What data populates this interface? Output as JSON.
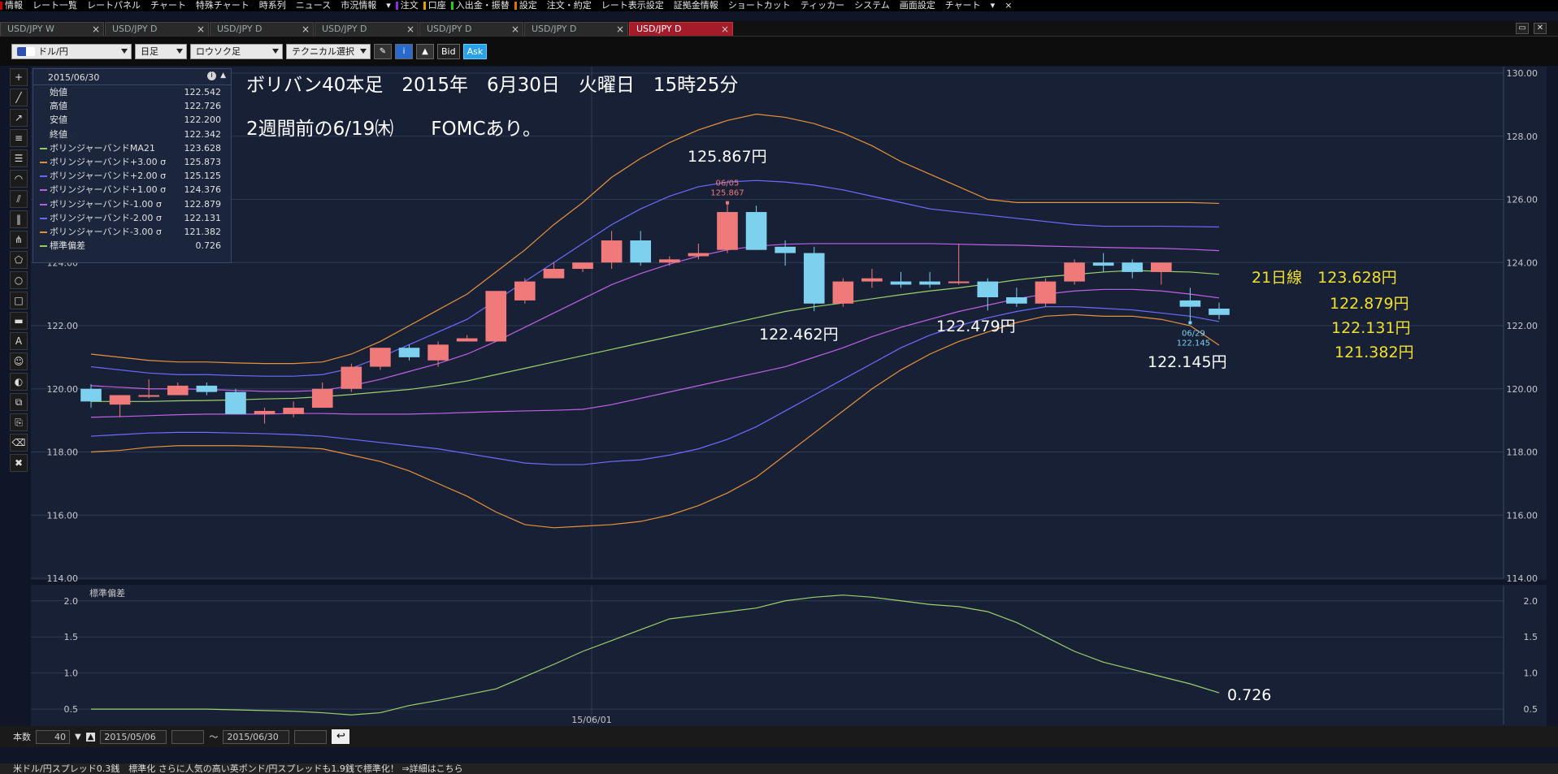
{
  "menu": [
    "情報",
    "レート一覧",
    "レートパネル",
    "チャート",
    "特殊チャート",
    "時系列",
    "ニュース",
    "市況情報",
    "▾",
    "注文",
    "口座",
    "入出金・振替",
    "設定",
    "注文・約定",
    "レート表示設定",
    "証拠金情報",
    "ショートカット",
    "ティッカー",
    "システム",
    "画面設定",
    "チャート",
    "▾",
    "×"
  ],
  "tabs": [
    {
      "label": "USD/JPY W",
      "active": false
    },
    {
      "label": "USD/JPY D",
      "active": false
    },
    {
      "label": "USD/JPY D",
      "active": false
    },
    {
      "label": "USD/JPY D",
      "active": false
    },
    {
      "label": "USD/JPY D",
      "active": false
    },
    {
      "label": "USD/JPY D",
      "active": false
    },
    {
      "label": "USD/JPY D",
      "active": true
    }
  ],
  "toolbar": {
    "pair": "ドル/円",
    "period": "日足",
    "chart_type": "ロウソク足",
    "technical": "テクニカル選択",
    "bid": "Bid",
    "ask": "Ask"
  },
  "info": {
    "date": "2015/06/30",
    "rows": [
      {
        "label": "始値",
        "value": "122.542",
        "color": ""
      },
      {
        "label": "高値",
        "value": "122.726",
        "color": ""
      },
      {
        "label": "安値",
        "value": "122.200",
        "color": ""
      },
      {
        "label": "終値",
        "value": "122.342",
        "color": ""
      },
      {
        "label": "ボリンジャーバンドMA21",
        "value": "123.628",
        "color": "#9ad26a"
      },
      {
        "label": "ボリンジャーバンド+3.00 σ",
        "value": "125.873",
        "color": "#e89238"
      },
      {
        "label": "ボリンジャーバンド+2.00 σ",
        "value": "125.125",
        "color": "#6c6cff"
      },
      {
        "label": "ボリンジャーバンド+1.00 σ",
        "value": "124.376",
        "color": "#c060e8"
      },
      {
        "label": "ボリンジャーバンド-1.00 σ",
        "value": "122.879",
        "color": "#c060e8"
      },
      {
        "label": "ボリンジャーバンド-2.00 σ",
        "value": "122.131",
        "color": "#6c6cff"
      },
      {
        "label": "ボリンジャーバンド-3.00 σ",
        "value": "121.382",
        "color": "#e89238"
      },
      {
        "label": "標準偏差",
        "value": "0.726",
        "color": "#9ad26a"
      }
    ]
  },
  "annotations": {
    "title": "ボリバン40本足　2015年　6月30日　火曜日　15時25分",
    "subtitle": "2週間前の6/19㈭　　FOMCあり。",
    "high_label": "125.867円",
    "low1": "122.462円",
    "low2": "122.479円",
    "low3": "122.145円",
    "ma21": "21日線　123.628円",
    "m1": "122.879円",
    "m2": "122.131円",
    "m3": "121.382円",
    "sd": "0.726",
    "hi_marker_date": "06/05",
    "hi_marker_val": "125.867",
    "lo_marker_date": "06/29",
    "lo_marker_val": "122.145",
    "sd_panel_label": "標準偏差",
    "x_tick": "15/06/01"
  },
  "chart_data": {
    "type": "candlestick",
    "ylim": [
      114,
      130
    ],
    "yticks": [
      "130.00",
      "128.00",
      "126.00",
      "124.00",
      "122.00",
      "120.00",
      "118.00",
      "116.00",
      "114.00"
    ],
    "sd_ylim": [
      0.4,
      2.2
    ],
    "sd_yticks": [
      "2.0",
      "1.5",
      "1.0",
      "0.5"
    ],
    "colors": {
      "up": "#f07a7a",
      "down": "#7dd0ee",
      "ma": "#9ad26a",
      "sigma1": "#c060e8",
      "sigma2": "#6c6cff",
      "sigma3": "#e89238",
      "sd": "#9ad26a"
    },
    "candles": [
      {
        "o": 120.0,
        "h": 120.15,
        "l": 119.4,
        "c": 119.6
      },
      {
        "o": 119.5,
        "h": 119.8,
        "l": 119.1,
        "c": 119.8
      },
      {
        "o": 119.8,
        "h": 120.3,
        "l": 119.7,
        "c": 119.8
      },
      {
        "o": 119.8,
        "h": 120.2,
        "l": 119.8,
        "c": 120.1
      },
      {
        "o": 120.1,
        "h": 120.2,
        "l": 119.8,
        "c": 119.9
      },
      {
        "o": 119.9,
        "h": 120.0,
        "l": 119.2,
        "c": 119.2
      },
      {
        "o": 119.2,
        "h": 119.4,
        "l": 118.9,
        "c": 119.3
      },
      {
        "o": 119.2,
        "h": 119.6,
        "l": 119.1,
        "c": 119.4
      },
      {
        "o": 119.4,
        "h": 120.2,
        "l": 119.4,
        "c": 120.0
      },
      {
        "o": 120.0,
        "h": 120.8,
        "l": 119.9,
        "c": 120.7
      },
      {
        "o": 120.7,
        "h": 121.3,
        "l": 120.6,
        "c": 121.3
      },
      {
        "o": 121.3,
        "h": 121.4,
        "l": 120.9,
        "c": 121.0
      },
      {
        "o": 120.9,
        "h": 121.5,
        "l": 120.7,
        "c": 121.4
      },
      {
        "o": 121.5,
        "h": 121.7,
        "l": 121.5,
        "c": 121.6
      },
      {
        "o": 121.5,
        "h": 123.1,
        "l": 121.5,
        "c": 123.1
      },
      {
        "o": 122.8,
        "h": 123.5,
        "l": 122.7,
        "c": 123.4
      },
      {
        "o": 123.5,
        "h": 124.0,
        "l": 123.5,
        "c": 123.8
      },
      {
        "o": 123.8,
        "h": 124.0,
        "l": 123.7,
        "c": 124.0
      },
      {
        "o": 124.0,
        "h": 125.0,
        "l": 123.8,
        "c": 124.7
      },
      {
        "o": 124.7,
        "h": 125.0,
        "l": 123.9,
        "c": 124.0
      },
      {
        "o": 124.0,
        "h": 124.2,
        "l": 123.9,
        "c": 124.1
      },
      {
        "o": 124.2,
        "h": 124.6,
        "l": 124.1,
        "c": 124.3
      },
      {
        "o": 124.4,
        "h": 125.87,
        "l": 124.3,
        "c": 125.6
      },
      {
        "o": 125.6,
        "h": 125.8,
        "l": 124.4,
        "c": 124.4
      },
      {
        "o": 124.5,
        "h": 124.7,
        "l": 123.9,
        "c": 124.3
      },
      {
        "o": 124.3,
        "h": 124.5,
        "l": 122.46,
        "c": 122.7
      },
      {
        "o": 122.7,
        "h": 123.5,
        "l": 122.6,
        "c": 123.4
      },
      {
        "o": 123.4,
        "h": 123.8,
        "l": 123.2,
        "c": 123.5
      },
      {
        "o": 123.4,
        "h": 123.7,
        "l": 123.2,
        "c": 123.3
      },
      {
        "o": 123.4,
        "h": 123.7,
        "l": 123.2,
        "c": 123.3
      },
      {
        "o": 123.4,
        "h": 124.6,
        "l": 123.3,
        "c": 123.4
      },
      {
        "o": 123.4,
        "h": 123.5,
        "l": 122.48,
        "c": 122.9
      },
      {
        "o": 122.9,
        "h": 123.2,
        "l": 122.6,
        "c": 122.7
      },
      {
        "o": 122.7,
        "h": 123.5,
        "l": 122.6,
        "c": 123.4
      },
      {
        "o": 123.4,
        "h": 124.1,
        "l": 123.3,
        "c": 124.0
      },
      {
        "o": 124.0,
        "h": 124.3,
        "l": 123.7,
        "c": 123.9
      },
      {
        "o": 124.0,
        "h": 124.1,
        "l": 123.5,
        "c": 123.7
      },
      {
        "o": 123.7,
        "h": 124.0,
        "l": 123.3,
        "c": 124.0
      },
      {
        "o": 122.8,
        "h": 123.2,
        "l": 122.15,
        "c": 122.6
      },
      {
        "o": 122.54,
        "h": 122.73,
        "l": 122.2,
        "c": 122.34
      }
    ],
    "ma": [
      119.6,
      119.6,
      119.6,
      119.62,
      119.63,
      119.65,
      119.68,
      119.7,
      119.75,
      119.82,
      119.9,
      119.98,
      120.1,
      120.25,
      120.45,
      120.65,
      120.85,
      121.05,
      121.25,
      121.45,
      121.65,
      121.85,
      122.05,
      122.25,
      122.45,
      122.6,
      122.72,
      122.85,
      122.98,
      123.1,
      123.2,
      123.32,
      123.45,
      123.55,
      123.62,
      123.7,
      123.75,
      123.72,
      123.7,
      123.628
    ],
    "s1u": [
      120.1,
      120.05,
      120.0,
      120.0,
      119.98,
      119.95,
      119.92,
      119.92,
      119.95,
      120.1,
      120.3,
      120.55,
      120.8,
      121.1,
      121.5,
      121.95,
      122.4,
      122.85,
      123.3,
      123.65,
      123.95,
      124.2,
      124.4,
      124.52,
      124.58,
      124.6,
      124.6,
      124.6,
      124.6,
      124.6,
      124.58,
      124.56,
      124.55,
      124.52,
      124.5,
      124.48,
      124.46,
      124.45,
      124.42,
      124.376
    ],
    "s1l": [
      119.1,
      119.12,
      119.15,
      119.18,
      119.2,
      119.2,
      119.2,
      119.22,
      119.22,
      119.2,
      119.2,
      119.2,
      119.22,
      119.25,
      119.28,
      119.3,
      119.32,
      119.35,
      119.5,
      119.7,
      119.9,
      120.1,
      120.3,
      120.5,
      120.7,
      121.0,
      121.3,
      121.65,
      121.95,
      122.2,
      122.45,
      122.65,
      122.85,
      123.0,
      123.1,
      123.15,
      123.15,
      123.1,
      123.0,
      122.879
    ],
    "s2u": [
      120.7,
      120.6,
      120.5,
      120.45,
      120.45,
      120.42,
      120.4,
      120.4,
      120.45,
      120.65,
      121.0,
      121.4,
      121.8,
      122.2,
      122.8,
      123.4,
      124.0,
      124.6,
      125.2,
      125.7,
      126.1,
      126.4,
      126.55,
      126.6,
      126.55,
      126.45,
      126.3,
      126.1,
      125.9,
      125.7,
      125.6,
      125.5,
      125.4,
      125.3,
      125.2,
      125.15,
      125.15,
      125.15,
      125.14,
      125.125
    ],
    "s2l": [
      118.5,
      118.55,
      118.6,
      118.62,
      118.62,
      118.6,
      118.58,
      118.55,
      118.5,
      118.4,
      118.3,
      118.2,
      118.1,
      117.95,
      117.8,
      117.65,
      117.6,
      117.6,
      117.7,
      117.75,
      117.9,
      118.1,
      118.4,
      118.8,
      119.3,
      119.8,
      120.3,
      120.8,
      121.3,
      121.7,
      122.0,
      122.25,
      122.45,
      122.6,
      122.6,
      122.55,
      122.5,
      122.4,
      122.3,
      122.131
    ],
    "s3u": [
      121.1,
      121.0,
      120.9,
      120.85,
      120.85,
      120.82,
      120.8,
      120.8,
      120.85,
      121.1,
      121.5,
      122.0,
      122.5,
      123.0,
      123.7,
      124.4,
      125.2,
      125.9,
      126.7,
      127.3,
      127.8,
      128.2,
      128.5,
      128.7,
      128.6,
      128.4,
      128.1,
      127.7,
      127.2,
      126.8,
      126.4,
      126.0,
      125.9,
      125.9,
      125.9,
      125.9,
      125.9,
      125.9,
      125.9,
      125.873
    ],
    "s3l": [
      118.0,
      118.05,
      118.15,
      118.2,
      118.2,
      118.2,
      118.18,
      118.15,
      118.1,
      117.9,
      117.7,
      117.4,
      117.0,
      116.6,
      116.1,
      115.7,
      115.6,
      115.65,
      115.7,
      115.8,
      116.0,
      116.3,
      116.7,
      117.2,
      117.9,
      118.6,
      119.3,
      120.0,
      120.6,
      121.1,
      121.5,
      121.8,
      122.1,
      122.3,
      122.35,
      122.3,
      122.3,
      122.2,
      122.0,
      121.382
    ],
    "sd": [
      0.5,
      0.5,
      0.5,
      0.5,
      0.5,
      0.49,
      0.48,
      0.47,
      0.45,
      0.42,
      0.45,
      0.55,
      0.62,
      0.7,
      0.78,
      0.95,
      1.12,
      1.3,
      1.45,
      1.6,
      1.75,
      1.8,
      1.85,
      1.9,
      2.0,
      2.05,
      2.08,
      2.05,
      2.0,
      1.95,
      1.92,
      1.85,
      1.7,
      1.5,
      1.3,
      1.15,
      1.05,
      0.95,
      0.85,
      0.726
    ]
  },
  "status": {
    "bars_label": "本数",
    "bars": "40",
    "from": "2015/05/06",
    "sep": "～",
    "to": "2015/06/30"
  },
  "ticker": "米ドル/円スプレッド0.3銭　標準化 さらに人気の高い英ポンド/円スプレッドも1.9銭で標準化！ ⇒詳細はこちら"
}
